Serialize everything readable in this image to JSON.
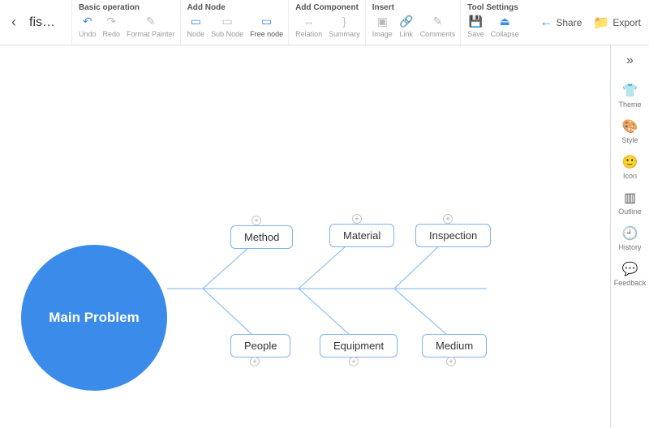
{
  "title": "fis…",
  "toolbar": {
    "groups": [
      {
        "label": "Basic operation",
        "items": [
          {
            "name": "undo",
            "label": "Undo",
            "icon": "↶",
            "gray": false
          },
          {
            "name": "redo",
            "label": "Redo",
            "icon": "↷",
            "gray": true
          },
          {
            "name": "format-painter",
            "label": "Format Painter",
            "icon": "✎",
            "gray": true
          }
        ]
      },
      {
        "label": "Add Node",
        "items": [
          {
            "name": "node",
            "label": "Node",
            "icon": "▭",
            "gray": false
          },
          {
            "name": "sub-node",
            "label": "Sub Node",
            "icon": "▭",
            "gray": true
          },
          {
            "name": "free-node",
            "label": "Free node",
            "icon": "▭",
            "gray": false,
            "dark": true
          }
        ]
      },
      {
        "label": "Add Component",
        "items": [
          {
            "name": "relation",
            "label": "Relation",
            "icon": "↔",
            "gray": true
          },
          {
            "name": "summary",
            "label": "Summary",
            "icon": "}",
            "gray": true
          }
        ]
      },
      {
        "label": "Insert",
        "items": [
          {
            "name": "image",
            "label": "Image",
            "icon": "▣",
            "gray": true
          },
          {
            "name": "link",
            "label": "Link",
            "icon": "🔗",
            "gray": true
          },
          {
            "name": "comments",
            "label": "Comments",
            "icon": "✎",
            "gray": true
          }
        ]
      },
      {
        "label": "Tool Settings",
        "items": [
          {
            "name": "save",
            "label": "Save",
            "icon": "💾",
            "gray": false
          },
          {
            "name": "collapse",
            "label": "Collapse",
            "icon": "⏏",
            "gray": false
          }
        ]
      }
    ],
    "right": [
      {
        "name": "share",
        "label": "Share",
        "icon": "←"
      },
      {
        "name": "export",
        "label": "Export",
        "icon": "📁"
      }
    ]
  },
  "sidebar": {
    "items": [
      {
        "name": "theme",
        "label": "Theme",
        "icon": "👕"
      },
      {
        "name": "style",
        "label": "Style",
        "icon": "🎨"
      },
      {
        "name": "icon",
        "label": "Icon",
        "icon": "🙂"
      },
      {
        "name": "outline",
        "label": "Outline",
        "icon": "▥"
      },
      {
        "name": "history",
        "label": "History",
        "icon": "🕘"
      },
      {
        "name": "feedback",
        "label": "Feedback",
        "icon": "💬"
      }
    ]
  },
  "diagram": {
    "type": "fishbone",
    "head": "Main Problem",
    "top_causes": [
      "Method",
      "Material",
      "Inspection"
    ],
    "bottom_causes": [
      "People",
      "Equipment",
      "Medium"
    ]
  },
  "chart_data": {
    "type": "fishbone",
    "effect": "Main Problem",
    "causes_top": [
      "Method",
      "Material",
      "Inspection"
    ],
    "causes_bottom": [
      "People",
      "Equipment",
      "Medium"
    ]
  }
}
